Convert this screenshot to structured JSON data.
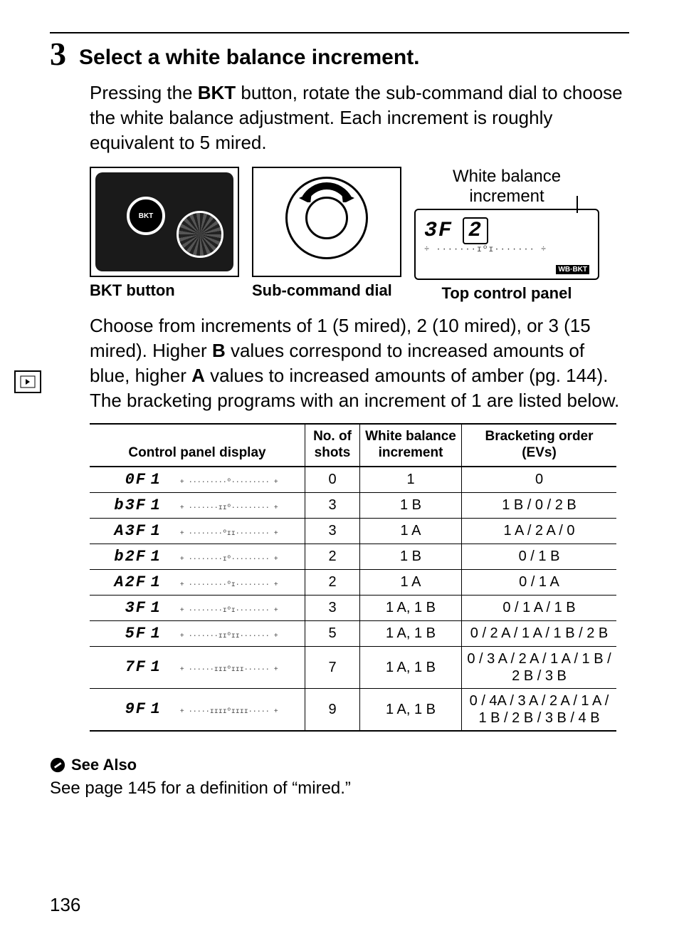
{
  "page_number": "136",
  "step": {
    "num": "3",
    "title": "Select a white balance increment."
  },
  "para1": {
    "pre": "Pressing the ",
    "bkt": "BKT",
    "post": " button, rotate the sub-command dial to choose the white balance adjustment.  Each increment is roughly equivalent to 5 mired."
  },
  "figs": {
    "bkt_caption": "BKT button",
    "sub_caption": "Sub-command dial",
    "lcd_label": "White balance increment",
    "lcd_main": "3F",
    "lcd_box": "2",
    "lcd_tag": "WB·BKT",
    "top_caption": "Top control panel"
  },
  "para2": {
    "a": "Choose from increments of 1 (5 mired), 2 (10 mired), or 3 (15 mired).  Higher ",
    "b": "B",
    "c": " values correspond to increased amounts of blue, higher ",
    "d": "A",
    "e": " values to increased amounts of amber (pg. 144).  The bracketing programs with an increment of 1 are listed below."
  },
  "table": {
    "headers": {
      "c1": "Control panel display",
      "c2": "No. of shots",
      "c3": "White balance increment",
      "c4": "Bracketing order (EVs)"
    },
    "rows": [
      {
        "code": "0F",
        "inc": "1",
        "scale": "+ ·········º········· +",
        "shots": "0",
        "wb": "1",
        "order": "0"
      },
      {
        "code": "b3F",
        "inc": "1",
        "scale": "+ ·······ɪɪº········· +",
        "shots": "3",
        "wb": "1 B",
        "order": "1 B / 0 / 2 B"
      },
      {
        "code": "A3F",
        "inc": "1",
        "scale": "+ ········ºɪɪ········ +",
        "shots": "3",
        "wb": "1 A",
        "order": "1 A / 2 A / 0"
      },
      {
        "code": "b2F",
        "inc": "1",
        "scale": "+ ········ɪº········· +",
        "shots": "2",
        "wb": "1 B",
        "order": "0 / 1 B"
      },
      {
        "code": "A2F",
        "inc": "1",
        "scale": "+ ·········ºɪ········ +",
        "shots": "2",
        "wb": "1 A",
        "order": "0 / 1 A"
      },
      {
        "code": "3F",
        "inc": "1",
        "scale": "+ ········ɪºɪ········ +",
        "shots": "3",
        "wb": "1 A, 1 B",
        "order": "0 / 1 A / 1 B"
      },
      {
        "code": "5F",
        "inc": "1",
        "scale": "+ ·······ɪɪºɪɪ······· +",
        "shots": "5",
        "wb": "1 A, 1 B",
        "order": "0 / 2 A / 1 A / 1 B / 2 B"
      },
      {
        "code": "7F",
        "inc": "1",
        "scale": "+ ······ɪɪɪºɪɪɪ······ +",
        "shots": "7",
        "wb": "1 A, 1 B",
        "order": "0 / 3 A / 2 A / 1 A / 1 B / 2 B / 3 B"
      },
      {
        "code": "9F",
        "inc": "1",
        "scale": "+ ·····ɪɪɪɪºɪɪɪɪ····· +",
        "shots": "9",
        "wb": "1 A, 1 B",
        "order": "0 / 4A / 3 A / 2 A / 1 A / 1 B / 2 B / 3 B / 4 B"
      }
    ]
  },
  "seealso": {
    "title": "See Also",
    "text": "See page 145 for a definition of “mired.”"
  }
}
